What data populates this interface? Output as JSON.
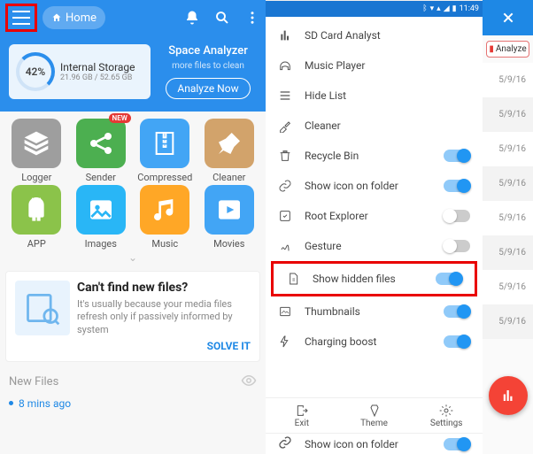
{
  "left": {
    "home_label": "Home",
    "storage": {
      "percent": "42%",
      "title": "Internal Storage",
      "usage": "21.96 GB / 52.65 GB"
    },
    "analyze": {
      "title": "Space Analyzer",
      "subtitle": "more files to clean",
      "button": "Analyze Now"
    },
    "grid": [
      {
        "label": "Logger",
        "badge": "",
        "bg": "bg1",
        "icon": "stack"
      },
      {
        "label": "Sender",
        "badge": "NEW",
        "bg": "bg2",
        "icon": "share"
      },
      {
        "label": "Compressed",
        "badge": "",
        "bg": "bg3",
        "icon": "zip"
      },
      {
        "label": "Cleaner",
        "badge": "",
        "bg": "bg4",
        "icon": "broom"
      },
      {
        "label": "APP",
        "badge": "",
        "bg": "bg5",
        "icon": "android"
      },
      {
        "label": "Images",
        "badge": "",
        "bg": "bg6",
        "icon": "image"
      },
      {
        "label": "Music",
        "badge": "",
        "bg": "bg7",
        "icon": "music"
      },
      {
        "label": "Movies",
        "badge": "",
        "bg": "bg8",
        "icon": "play"
      }
    ],
    "promo": {
      "title": "Can't find new files?",
      "body": "It's usually because your media files refresh only if passively informed by system",
      "cta": "SOLVE IT"
    },
    "newfiles_label": "New Files",
    "newfiles_item": "8 mins ago"
  },
  "settings": {
    "status_time": "11:49",
    "items": [
      {
        "label": "SD Card Analyst",
        "toggle": "",
        "icon": "bars"
      },
      {
        "label": "Music Player",
        "toggle": "",
        "icon": "headphone"
      },
      {
        "label": "Hide List",
        "toggle": "",
        "icon": "list"
      },
      {
        "label": "Cleaner",
        "toggle": "",
        "icon": "brush"
      },
      {
        "label": "Recycle Bin",
        "toggle": "on",
        "icon": "trash"
      },
      {
        "label": "Show icon on folder",
        "toggle": "on",
        "icon": "link"
      },
      {
        "label": "Root Explorer",
        "toggle": "off",
        "icon": "root"
      },
      {
        "label": "Gesture",
        "toggle": "off",
        "icon": "gesture"
      },
      {
        "label": "Show hidden files",
        "toggle": "on",
        "icon": "file",
        "highlight": true
      },
      {
        "label": "Thumbnails",
        "toggle": "on",
        "icon": "thumb"
      },
      {
        "label": "Charging boost",
        "toggle": "on",
        "icon": "bolt"
      }
    ],
    "bottom": [
      {
        "label": "Exit",
        "icon": "exit"
      },
      {
        "label": "Theme",
        "icon": "theme"
      },
      {
        "label": "Settings",
        "icon": "gear"
      }
    ],
    "peek_label": "Show icon on folder"
  },
  "right": {
    "analyze_chip": "Analyze",
    "dates": [
      "5/9/16",
      "5/9/16",
      "5/9/16",
      "5/9/16",
      "5/9/16",
      "5/9/16",
      "5/9/16",
      "5/9/16"
    ]
  }
}
